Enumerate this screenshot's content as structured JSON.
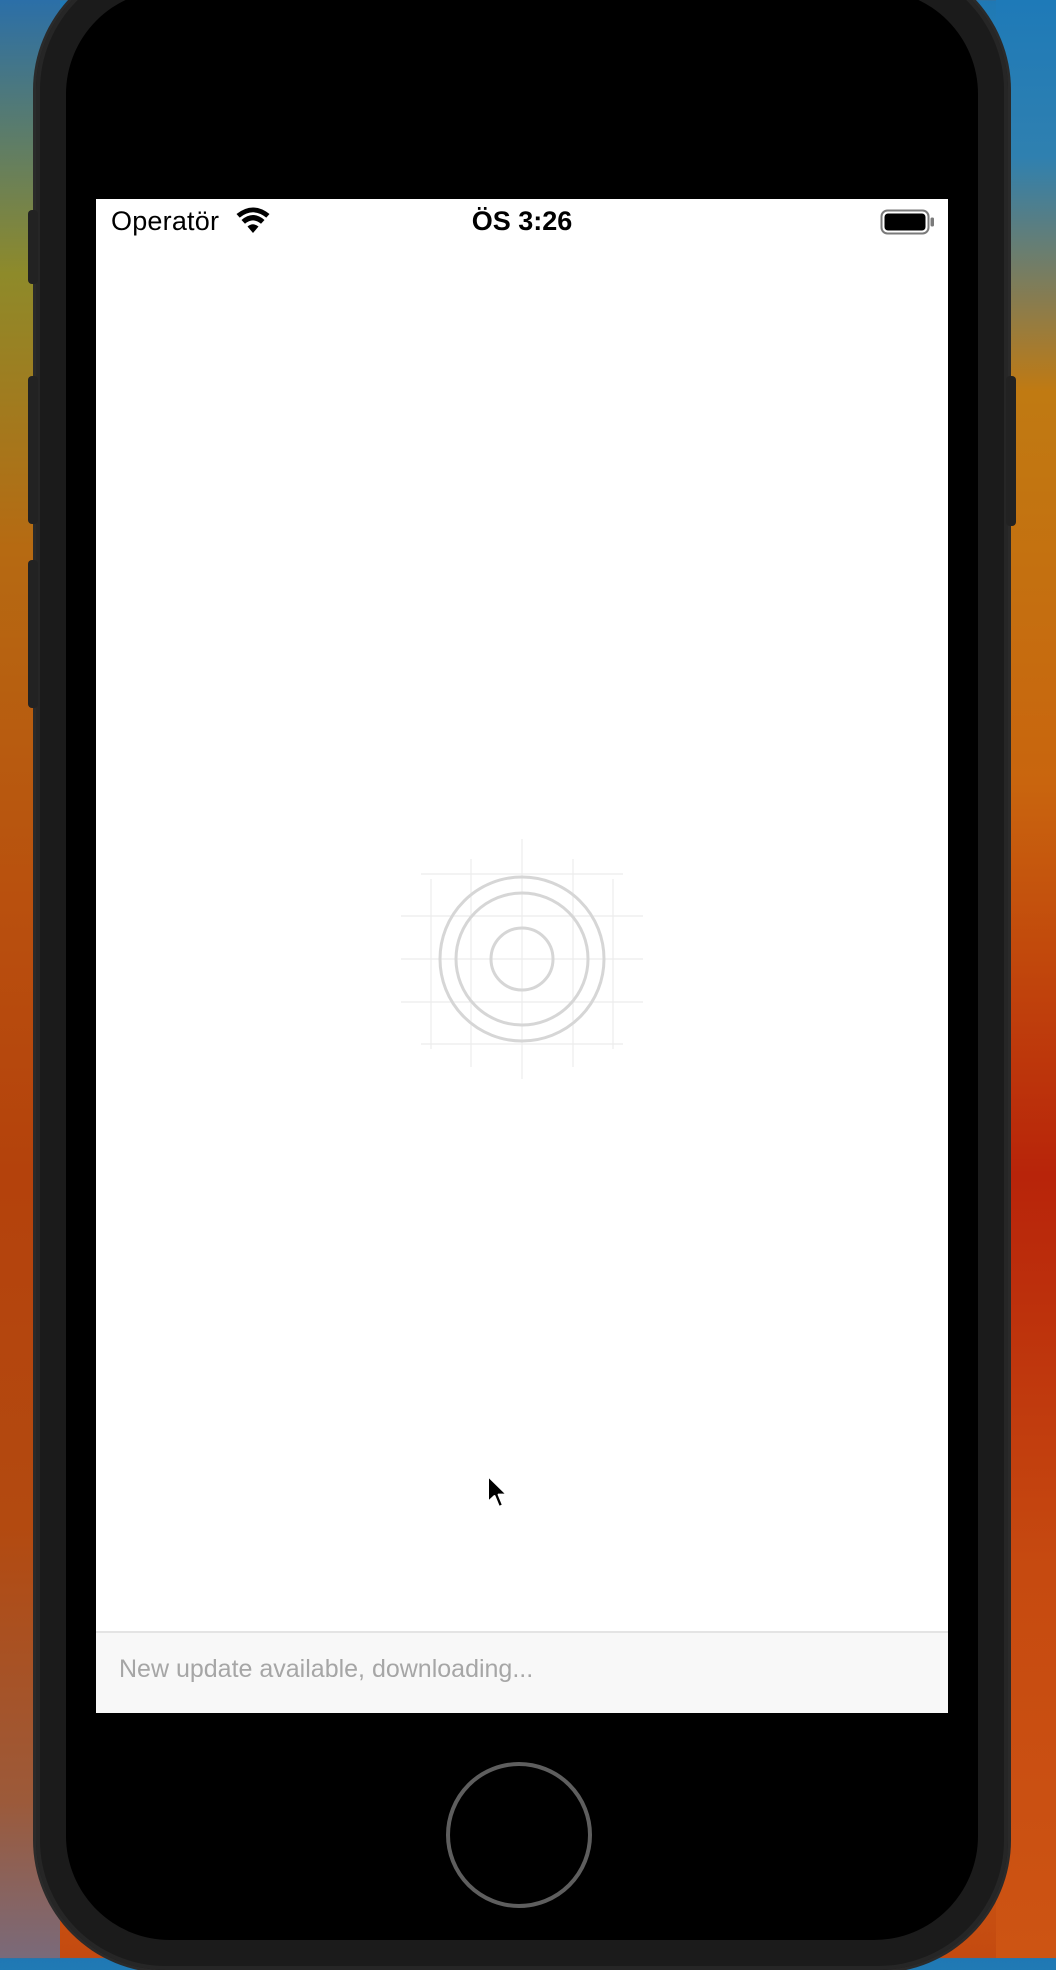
{
  "status_bar": {
    "carrier": "Operatör",
    "time": "ÖS 3:26",
    "wifi_icon": "wifi-icon",
    "battery_icon": "battery-icon"
  },
  "splash": {
    "logo_icon": "app-logo-icon"
  },
  "update_banner": {
    "text": "New update available, downloading..."
  },
  "device": {
    "home_button_icon": "home-button"
  },
  "colors": {
    "screen_background": "#ffffff",
    "banner_background": "#f8f8f8",
    "banner_text": "#a6a6a6",
    "logo_stroke": "#d6d6d6"
  }
}
